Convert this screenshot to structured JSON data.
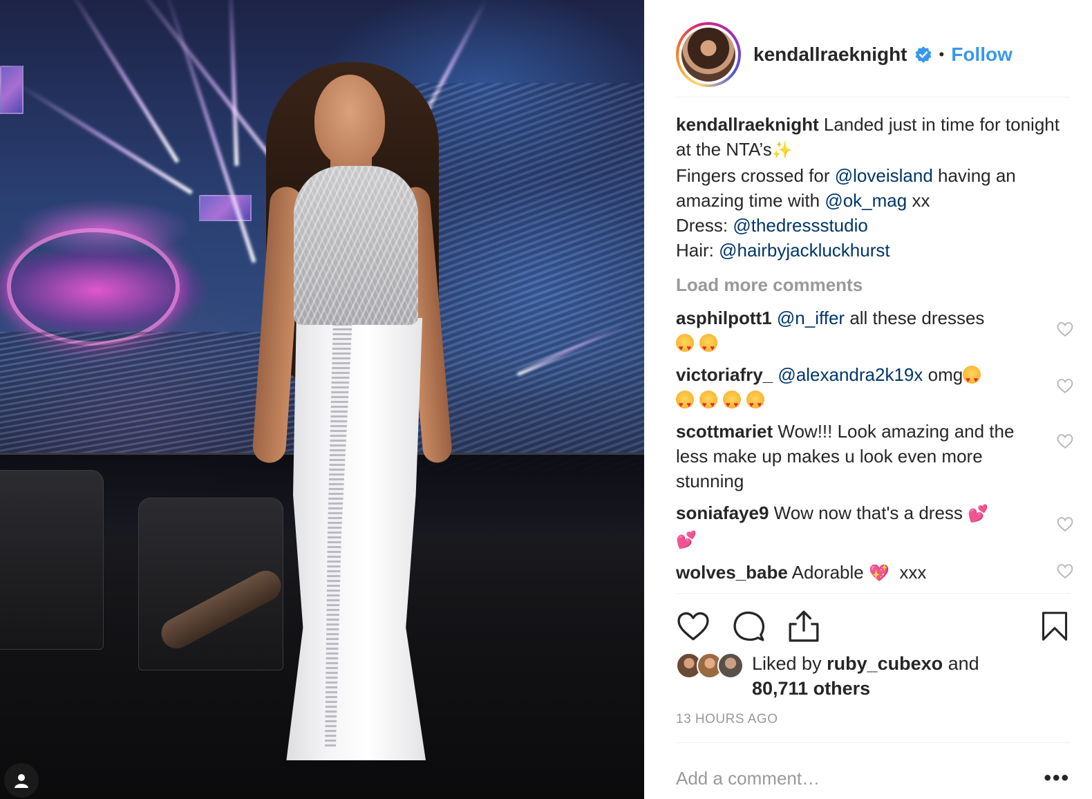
{
  "post": {
    "username": "kendallraeknight",
    "follow_label": "Follow",
    "dot": "•",
    "caption": {
      "user": "kendallraeknight",
      "line1": "Landed just in time for tonight at the NTA’s",
      "line2_a": "Fingers crossed for ",
      "mention1": "@loveisland",
      "line2_b": " having an amazing time with ",
      "mention2": "@ok_mag",
      "line2_c": " xx",
      "dress_label": "Dress: ",
      "dress_mention": "@thedressstudio",
      "hair_label": "Hair: ",
      "hair_mention": "@hairbyjackluckhurst"
    },
    "load_more": "Load more comments",
    "comments": [
      {
        "user": "asphilpott1",
        "mention": "@n_iffer",
        "text": " all these dresses"
      },
      {
        "user": "victoriafry_",
        "mention": "@alexandra2k19x",
        "text": " omg"
      },
      {
        "user": "scottmariet",
        "text": "Wow!!! Look amazing and the less make up makes u look even more stunning"
      },
      {
        "user": "soniafaye9",
        "text": "Wow now that's a dress"
      },
      {
        "user": "wolves_babe",
        "text": "Adorable",
        "text2": "xxx"
      }
    ],
    "likes": {
      "prefix": "Liked by ",
      "user": "ruby_cubexo",
      "and": " and",
      "others": "80,711 others"
    },
    "timestamp": "13 HOURS AGO",
    "comment_placeholder": "Add a comment…",
    "more_label": "•••"
  },
  "colors": {
    "accent": "#3897f0",
    "mention": "#003569",
    "muted": "#999999",
    "text": "#262626"
  },
  "icons": [
    "verified-badge-icon",
    "heart-icon",
    "comment-icon",
    "share-icon",
    "bookmark-icon",
    "user-icon"
  ]
}
